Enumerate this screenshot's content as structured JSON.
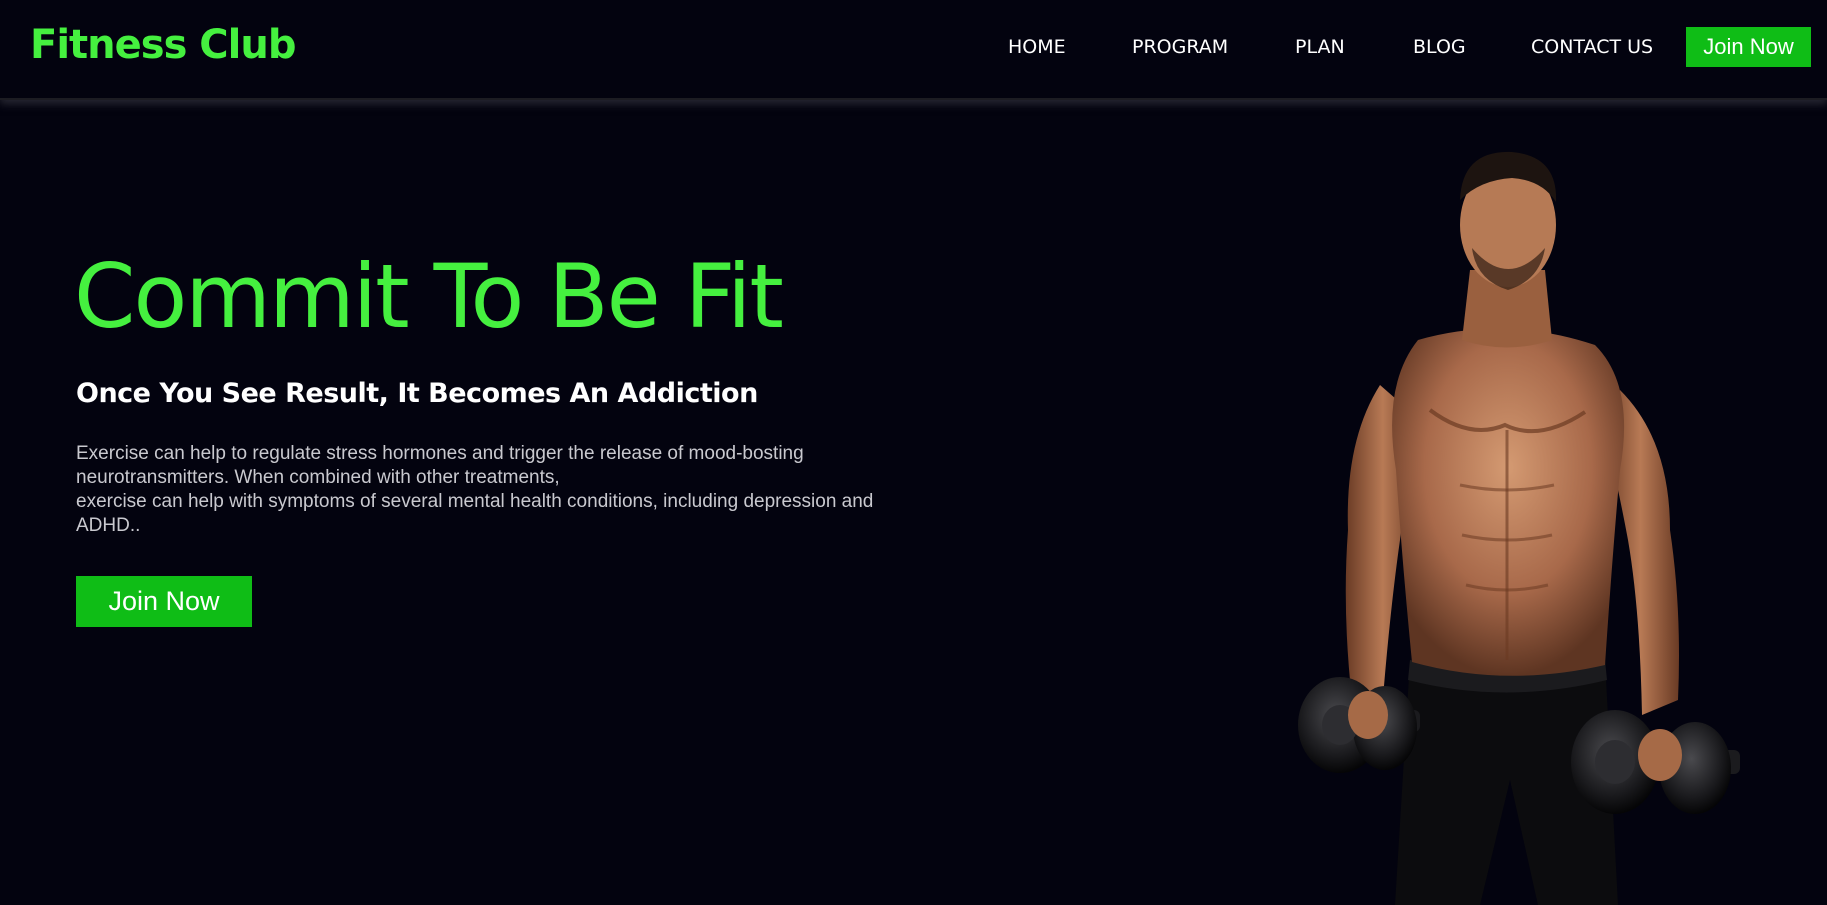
{
  "brand": {
    "name": "Fitness Club",
    "color": "#45f03f"
  },
  "nav": {
    "links": [
      {
        "label": "HOME"
      },
      {
        "label": "PROGRAM"
      },
      {
        "label": "PLAN"
      },
      {
        "label": "BLOG"
      },
      {
        "label": "CONTACT US"
      }
    ],
    "cta_label": "Join Now"
  },
  "hero": {
    "title": "Commit To Be Fit",
    "subtitle": "Once You See Result, It Becomes An Addiction",
    "body_lines": [
      "Exercise can help to regulate stress hormones and trigger the release of mood-bosting",
      "neurotransmitters. When combined with other treatments,",
      "exercise can help with symptoms of several mental health conditions, including depression and",
      "ADHD.."
    ],
    "cta_label": "Join Now",
    "image_subject": "muscular-man-with-dumbbells"
  },
  "colors": {
    "background": "#03030f",
    "accent_green": "#45f03f",
    "button_green": "#0fbd16",
    "text_white": "#ffffff",
    "text_muted": "#c9c9cf"
  }
}
